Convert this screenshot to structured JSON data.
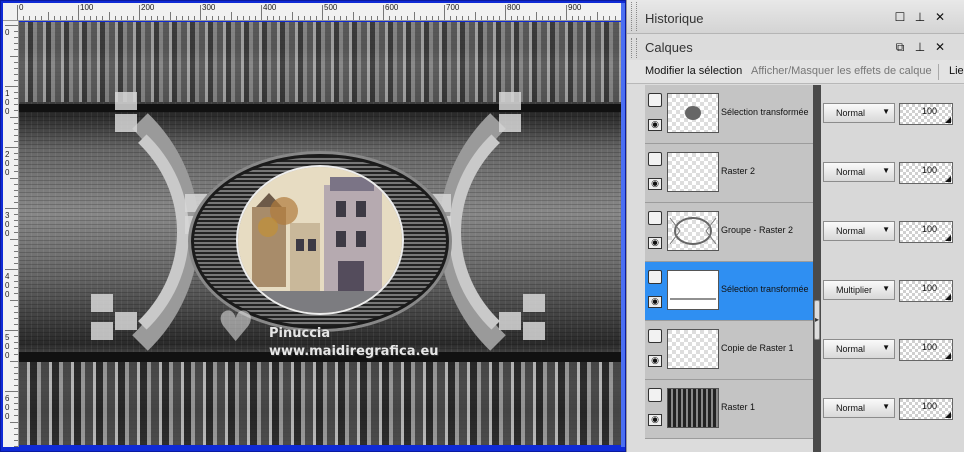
{
  "ruler": {
    "top_labels": [
      "0",
      "100",
      "200",
      "300",
      "400",
      "500",
      "600",
      "700",
      "800",
      "900"
    ],
    "left_labels": [
      "0",
      "100",
      "200",
      "300",
      "400",
      "500",
      "600"
    ]
  },
  "watermark": {
    "name": "Pinuccia",
    "url": "www.maidiregrafica.eu"
  },
  "panels": {
    "historique": {
      "title": "Historique"
    },
    "calques": {
      "title": "Calques"
    }
  },
  "toolbar": {
    "modifier_selection": "Modifier la sélection",
    "afficher_masquer": "Afficher/Masquer les effets de calque",
    "lie": "Lie"
  },
  "layers": [
    {
      "name": "Sélection transformée",
      "blend": "Normal",
      "opacity": "100",
      "selected": false,
      "thumb": "photo-thumb"
    },
    {
      "name": "Raster 2",
      "blend": "Normal",
      "opacity": "100",
      "selected": false,
      "thumb": "empty-thumb"
    },
    {
      "name": "Groupe - Raster 2",
      "blend": "Normal",
      "opacity": "100",
      "selected": false,
      "thumb": "pattern-thumb"
    },
    {
      "name": "Sélection transformée",
      "blend": "Multiplier",
      "opacity": "100",
      "selected": true,
      "thumb": "line-thumb"
    },
    {
      "name": "Copie de Raster 1",
      "blend": "Normal",
      "opacity": "100",
      "selected": false,
      "thumb": "empty-thumb"
    },
    {
      "name": "Raster 1",
      "blend": "Normal",
      "opacity": "100",
      "selected": false,
      "thumb": "dark-thumb"
    }
  ],
  "colors": {
    "canvas_frame": "#0f2ad6",
    "selected_layer": "#2f8ff2",
    "panel_bg": "#dcdcdc"
  },
  "icons": {
    "minimize": "minimize-icon",
    "pin": "pin-icon",
    "close": "close-icon",
    "eye": "eye-icon",
    "layer_visibility": "layer-box-icon",
    "dropdown": "chevron-down-icon"
  }
}
